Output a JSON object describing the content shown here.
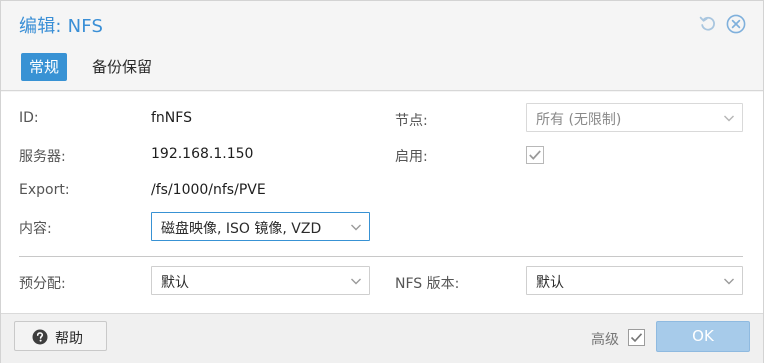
{
  "dialog": {
    "title": "编辑: NFS"
  },
  "tabs": [
    {
      "label": "常规",
      "active": true
    },
    {
      "label": "备份保留",
      "active": false
    }
  ],
  "general": {
    "id_label": "ID:",
    "id_value": "fnNFS",
    "server_label": "服务器:",
    "server_value": "192.168.1.150",
    "export_label": "Export:",
    "export_value": "/fs/1000/nfs/PVE",
    "content_label": "内容:",
    "content_value": "磁盘映像, ISO 镜像, VZD",
    "node_label": "节点:",
    "node_value": "所有 (无限制)",
    "enable_label": "启用:",
    "enable_checked": true,
    "prealloc_label": "预分配:",
    "prealloc_value": "默认",
    "nfs_version_label": "NFS 版本:",
    "nfs_version_value": "默认"
  },
  "footer": {
    "help_label": "帮助",
    "advanced_label": "高级",
    "advanced_checked": true,
    "ok_label": "OK"
  },
  "colors": {
    "accent": "#3892d4",
    "title": "#3a8fd6",
    "ok_disabled": "#a7cbea"
  },
  "icons": {
    "refresh": "refresh-icon",
    "close": "close-icon",
    "help": "question-circle-icon",
    "dropdown": "chevron-down-icon"
  }
}
